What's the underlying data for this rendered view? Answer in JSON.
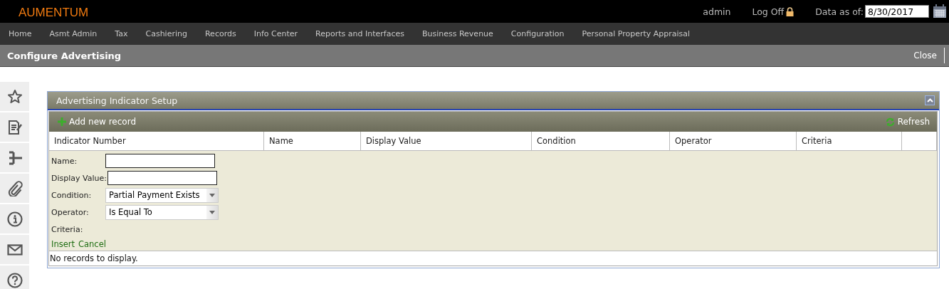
{
  "app": {
    "logo": "AUMENTUM",
    "user": "admin",
    "logoff": "Log Off",
    "data_as_of_label": "Data as of:",
    "data_as_of": "8/30/2017"
  },
  "nav": [
    "Home",
    "Asmt Admin",
    "Tax",
    "Cashiering",
    "Records",
    "Info Center",
    "Reports and Interfaces",
    "Business Revenue",
    "Configuration",
    "Personal Property Appraisal"
  ],
  "page": {
    "title": "Configure Advertising",
    "close": "Close"
  },
  "sidebar": [
    {
      "kind": "star"
    },
    {
      "kind": "notes"
    },
    {
      "kind": "tree"
    },
    {
      "kind": "clip"
    },
    {
      "kind": "info"
    },
    {
      "kind": "mail"
    },
    {
      "kind": "help"
    }
  ],
  "panel": {
    "title": "Advertising Indicator Setup",
    "expanded": true,
    "add": "Add new record",
    "refresh": "Refresh",
    "columns": [
      "Indicator Number",
      "Name",
      "Display Value",
      "Condition",
      "Operator",
      "Criteria"
    ],
    "form": [
      {
        "label": "Name:",
        "kind": "text"
      },
      {
        "label": "Display Value:",
        "kind": "text"
      },
      {
        "label": "Condition:",
        "kind": "select",
        "value": "Partial Payment Exists"
      },
      {
        "label": "Operator:",
        "kind": "select",
        "value": "Is Equal To"
      },
      {
        "label": "Criteria:",
        "kind": "none"
      }
    ],
    "actions": [
      "Insert",
      "Cancel"
    ],
    "empty": "No records to display."
  }
}
